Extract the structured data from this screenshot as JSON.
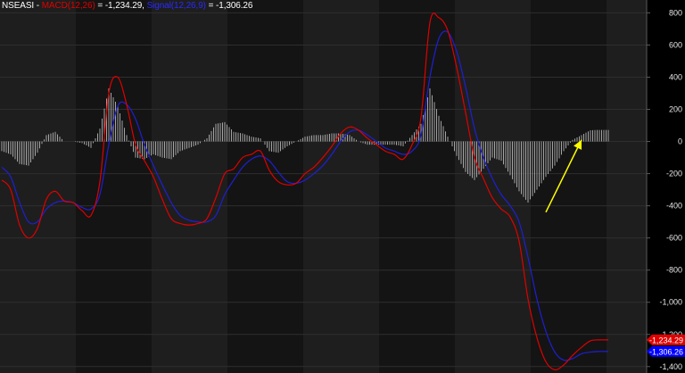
{
  "legend": {
    "symbol": "NSEASI",
    "sep1": " - ",
    "macd_label": "MACD(12,26)",
    "macd_eq": " = ",
    "macd_value": "-1,234.29,",
    "signal_label": "Signal(12,26,9)",
    "signal_eq": " = ",
    "signal_value": "-1,306.26"
  },
  "colors": {
    "background": "#000000",
    "band_light": "#1e1e1e",
    "band_dark": "#141414",
    "gridline": "#2e2e2e",
    "macd": "#e00000",
    "signal": "#1f1fd6",
    "histogram": "#c8c8c8",
    "arrow": "#ffff00",
    "macd_badge": "#e00000",
    "signal_badge": "#0000ff"
  },
  "badges": {
    "macd": "-1,234.29",
    "signal": "-1,306.26"
  },
  "chart_data": {
    "type": "line",
    "ylim": [
      -1440,
      880
    ],
    "xlim": [
      0,
      140
    ],
    "yticks": [
      800,
      600,
      400,
      200,
      0,
      -200,
      -400,
      -600,
      -800,
      -1000,
      -1200,
      -1400
    ],
    "ytick_labels": [
      "800",
      "600",
      "400",
      "200",
      "0",
      "-200",
      "-400",
      "-600",
      "-800",
      "-1,000",
      "-1,200",
      "-1,400"
    ],
    "grid": true,
    "series": [
      {
        "key": "macd",
        "x": [
          0,
          2,
          4,
          6,
          8,
          10,
          12,
          14,
          16,
          18,
          20,
          22,
          24,
          26,
          28,
          30,
          32,
          34,
          36,
          38,
          40,
          42,
          44,
          46,
          48,
          50,
          52,
          54,
          56,
          58,
          60,
          62,
          64,
          66,
          68,
          70,
          72,
          74,
          76,
          78,
          80,
          82,
          84,
          86,
          88,
          90,
          92,
          94,
          96,
          98,
          100,
          102,
          104,
          106,
          108,
          110,
          112,
          114,
          116,
          118,
          120,
          122,
          124,
          126,
          128,
          130,
          132,
          134,
          136,
          138,
          140
        ],
        "values": [
          -240,
          -300,
          -520,
          -600,
          -540,
          -360,
          -310,
          -370,
          -380,
          -430,
          -460,
          -250,
          300,
          400,
          230,
          -20,
          -120,
          -220,
          -360,
          -480,
          -510,
          -520,
          -510,
          -480,
          -350,
          -200,
          -170,
          -100,
          -80,
          -60,
          -180,
          -250,
          -270,
          -260,
          -200,
          -160,
          -100,
          -30,
          50,
          90,
          70,
          20,
          -20,
          -60,
          -80,
          -110,
          -20,
          150,
          740,
          770,
          690,
          460,
          180,
          -100,
          -230,
          -350,
          -420,
          -470,
          -620,
          -980,
          -1220,
          -1370,
          -1420,
          -1390,
          -1330,
          -1280,
          -1240,
          -1234,
          -1234,
          -1234,
          -1234
        ]
      },
      {
        "key": "signal",
        "x": [
          0,
          2,
          4,
          6,
          8,
          10,
          12,
          14,
          16,
          18,
          20,
          22,
          24,
          26,
          28,
          30,
          32,
          34,
          36,
          38,
          40,
          42,
          44,
          46,
          48,
          50,
          52,
          54,
          56,
          58,
          60,
          62,
          64,
          66,
          68,
          70,
          72,
          74,
          76,
          78,
          80,
          82,
          84,
          86,
          88,
          90,
          92,
          94,
          96,
          98,
          100,
          102,
          104,
          106,
          108,
          110,
          112,
          114,
          116,
          118,
          120,
          122,
          124,
          126,
          128,
          130,
          132,
          134,
          136,
          138,
          140
        ],
        "values": [
          -160,
          -220,
          -380,
          -500,
          -500,
          -420,
          -380,
          -370,
          -380,
          -410,
          -420,
          -330,
          -20,
          220,
          230,
          140,
          -20,
          -150,
          -270,
          -380,
          -460,
          -490,
          -500,
          -500,
          -460,
          -330,
          -240,
          -160,
          -110,
          -90,
          -120,
          -190,
          -250,
          -260,
          -240,
          -200,
          -150,
          -80,
          0,
          60,
          70,
          40,
          0,
          -40,
          -60,
          -80,
          -60,
          40,
          400,
          640,
          680,
          560,
          340,
          80,
          -100,
          -230,
          -330,
          -400,
          -500,
          -720,
          -980,
          -1180,
          -1310,
          -1360,
          -1350,
          -1320,
          -1310,
          -1306,
          -1306,
          -1306,
          -1306
        ]
      },
      {
        "key": "histogram",
        "x": [
          0,
          2,
          4,
          6,
          8,
          10,
          12,
          14,
          16,
          18,
          20,
          22,
          24,
          26,
          28,
          30,
          32,
          34,
          36,
          38,
          40,
          42,
          44,
          46,
          48,
          50,
          52,
          54,
          56,
          58,
          60,
          62,
          64,
          66,
          68,
          70,
          72,
          74,
          76,
          78,
          80,
          82,
          84,
          86,
          88,
          90,
          92,
          94,
          96,
          98,
          100,
          102,
          104,
          106,
          108,
          110,
          112,
          114,
          116,
          118,
          120,
          122,
          124,
          126,
          128,
          130,
          132,
          134,
          136,
          138,
          140
        ],
        "values": [
          -60,
          -80,
          -140,
          -150,
          -70,
          40,
          60,
          0,
          0,
          -10,
          -40,
          80,
          330,
          220,
          40,
          -100,
          -110,
          -80,
          -100,
          -110,
          -60,
          -40,
          -20,
          20,
          110,
          120,
          60,
          50,
          30,
          20,
          -60,
          -70,
          -30,
          0,
          30,
          40,
          40,
          50,
          50,
          40,
          0,
          -20,
          -20,
          -20,
          -20,
          -30,
          40,
          110,
          330,
          160,
          30,
          -90,
          -190,
          -240,
          -170,
          -100,
          -120,
          -210,
          -310,
          -380,
          -300,
          -220,
          -150,
          -60,
          10,
          40,
          70,
          72,
          72,
          72,
          72
        ]
      }
    ],
    "annotations": [
      {
        "type": "arrow",
        "from": [
          122,
          -440
        ],
        "to": [
          130,
          10
        ]
      }
    ]
  }
}
